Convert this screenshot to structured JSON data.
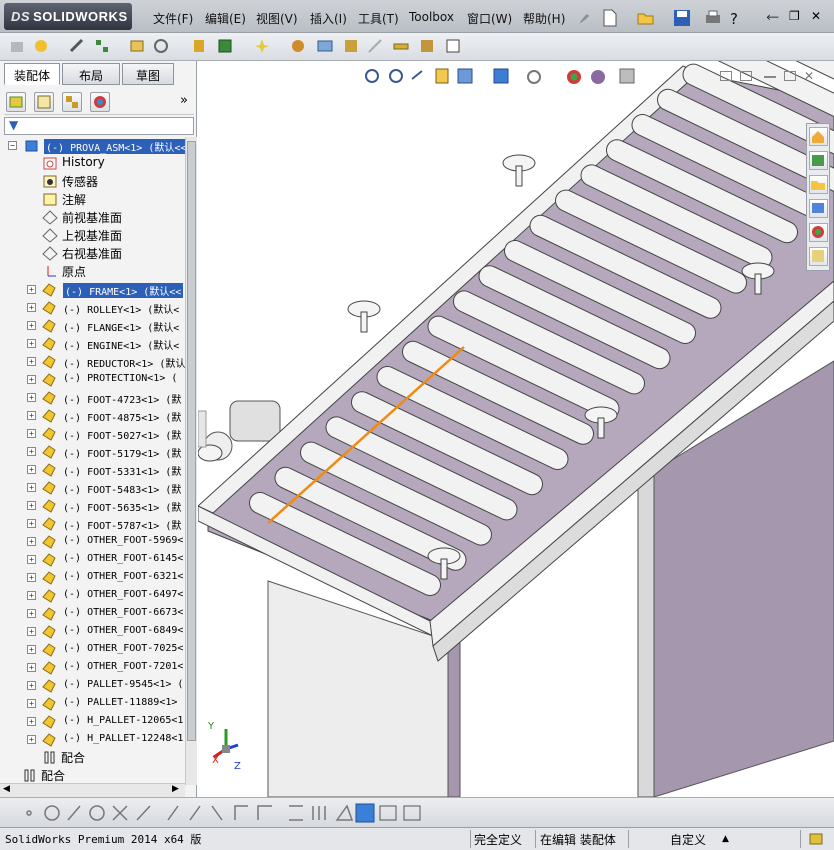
{
  "app": {
    "logo_prefix": "DS",
    "logo_main": "SOLIDWORKS"
  },
  "menu": [
    "文件(F)",
    "编辑(E)",
    "视图(V)",
    "插入(I)",
    "工具(T)",
    "Toolbox",
    "窗口(W)",
    "帮助(H)"
  ],
  "window_controls": {
    "help_label": "?",
    "extra_label": "‹",
    "minimize": "—",
    "restore": "❐",
    "close": "✕"
  },
  "panel": {
    "tabs": [
      "装配体",
      "布局",
      "草图"
    ],
    "active_tab": 0,
    "filter_icon": "funnel-icon",
    "expand_label": "»"
  },
  "tree": {
    "root": "(-) PROVA_ASM<1> (默认<<",
    "fixed_items": [
      {
        "label": "History",
        "icon": "history-icon"
      },
      {
        "label": "传感器",
        "icon": "sensor-icon"
      },
      {
        "label": "注解",
        "icon": "annotation-icon"
      },
      {
        "label": "前视基准面",
        "icon": "plane-icon"
      },
      {
        "label": "上视基准面",
        "icon": "plane-icon"
      },
      {
        "label": "右视基准面",
        "icon": "plane-icon"
      },
      {
        "label": "原点",
        "icon": "origin-icon"
      }
    ],
    "components": [
      "(-) FRAME<1> (默认<<",
      "(-) ROLLEY<1> (默认<",
      "(-) FLANGE<1> (默认<",
      "(-) ENGINE<1> (默认<",
      "(-) REDUCTOR<1> (默认",
      "(-) PROTECTION<1> (",
      "(-) FOOT-4723<1> (默",
      "(-) FOOT-4875<1> (默",
      "(-) FOOT-5027<1> (默",
      "(-) FOOT-5179<1> (默",
      "(-) FOOT-5331<1> (默",
      "(-) FOOT-5483<1> (默",
      "(-) FOOT-5635<1> (默",
      "(-) FOOT-5787<1> (默",
      "(-) OTHER_FOOT-5969<",
      "(-) OTHER_FOOT-6145<",
      "(-) OTHER_FOOT-6321<",
      "(-) OTHER_FOOT-6497<",
      "(-) OTHER_FOOT-6673<",
      "(-) OTHER_FOOT-6849<",
      "(-) OTHER_FOOT-7025<",
      "(-) OTHER_FOOT-7201<",
      "(-) PALLET-9545<1> (",
      "(-) PALLET-11889<1>",
      "(-) H_PALLET-12065<1",
      "(-) H_PALLET-12248<1"
    ],
    "mates_inner": "配合",
    "mates_outer": "配合"
  },
  "viewport": {
    "triad": {
      "x": "X",
      "y": "Y",
      "z": "Z"
    }
  },
  "statusbar": {
    "product": "SolidWorks Premium 2014 x64 版",
    "state1": "完全定义",
    "state2": "在编辑 装配体",
    "custom": "自定义",
    "arrow": "▲"
  },
  "colors": {
    "frame_purple": "#a597ad",
    "roller": "#f2f2f2",
    "selection": "#2c5fb8",
    "line_orange": "#f08a10"
  }
}
